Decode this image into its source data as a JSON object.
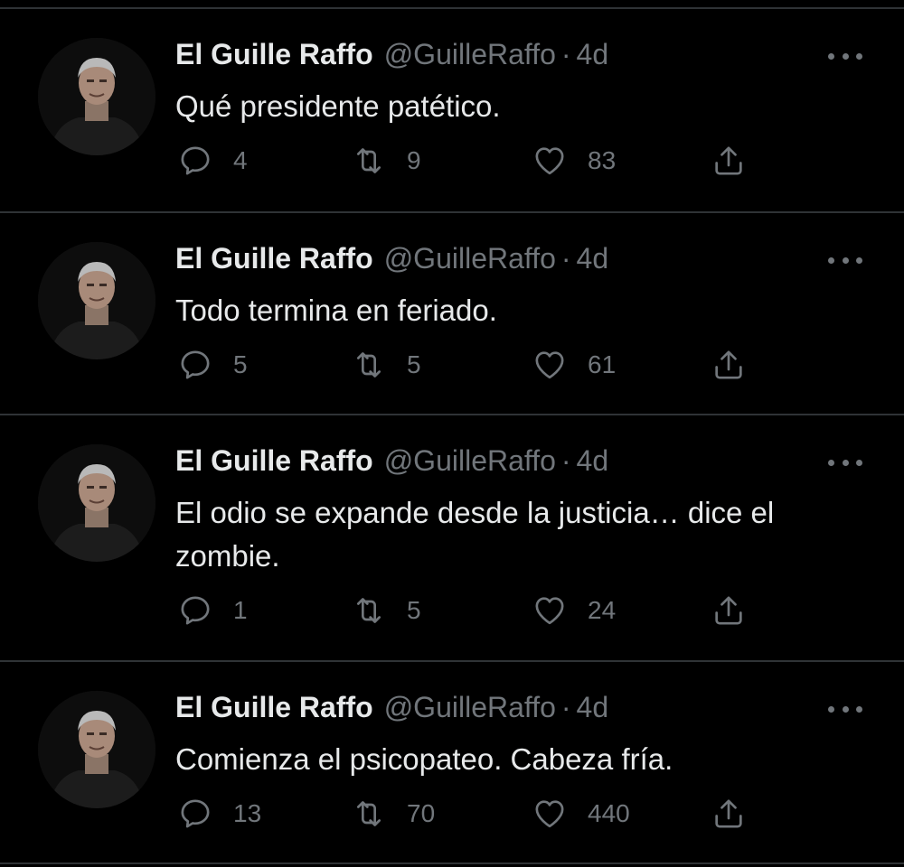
{
  "feed": {
    "tweets": [
      {
        "author_name": "El Guille Raffo",
        "author_handle": "@GuilleRaffo",
        "separator": "·",
        "time": "4d",
        "text": "Qué presidente patético.",
        "replies": "4",
        "retweets": "9",
        "likes": "83"
      },
      {
        "author_name": "El Guille Raffo",
        "author_handle": "@GuilleRaffo",
        "separator": "·",
        "time": "4d",
        "text": "Todo termina en feriado.",
        "replies": "5",
        "retweets": "5",
        "likes": "61"
      },
      {
        "author_name": "El Guille Raffo",
        "author_handle": "@GuilleRaffo",
        "separator": "·",
        "time": "4d",
        "text": "El odio se expande desde la justicia… dice el zombie.",
        "replies": "1",
        "retweets": "5",
        "likes": "24"
      },
      {
        "author_name": "El Guille Raffo",
        "author_handle": "@GuilleRaffo",
        "separator": "·",
        "time": "4d",
        "text": "Comienza el psicopateo. Cabeza fría.",
        "replies": "13",
        "retweets": "70",
        "likes": "440"
      }
    ]
  },
  "icons": {
    "reply": "reply-icon",
    "retweet": "retweet-icon",
    "like": "heart-icon",
    "share": "share-icon",
    "more": "more-icon"
  },
  "colors": {
    "background": "#000000",
    "text": "#e7e9ea",
    "secondary": "#71767b",
    "divider": "#2f3336"
  }
}
